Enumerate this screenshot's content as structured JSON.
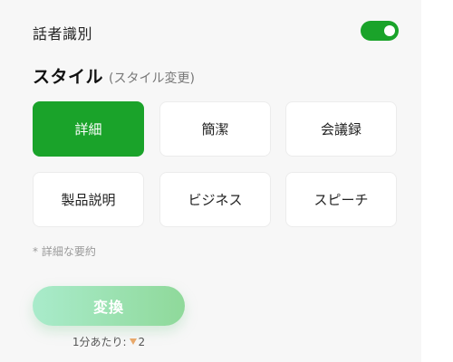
{
  "speaker_identification": {
    "label": "話者識別",
    "enabled": true
  },
  "style_section": {
    "title": "スタイル",
    "subtitle": "(スタイル変更)",
    "options": [
      {
        "label": "詳細",
        "selected": true
      },
      {
        "label": "簡潔",
        "selected": false
      },
      {
        "label": "会議録",
        "selected": false
      },
      {
        "label": "製品説明",
        "selected": false
      },
      {
        "label": "ビジネス",
        "selected": false
      },
      {
        "label": "スピーチ",
        "selected": false
      }
    ],
    "note": "* 詳細な要約"
  },
  "convert": {
    "label": "変換",
    "cost_prefix": "1分あたり:",
    "cost_value": "2",
    "cost_icon": "gem-icon"
  },
  "colors": {
    "accent": "#1aa32a",
    "convert_gradient_start": "#a9ebcb",
    "convert_gradient_end": "#8fd99a"
  }
}
